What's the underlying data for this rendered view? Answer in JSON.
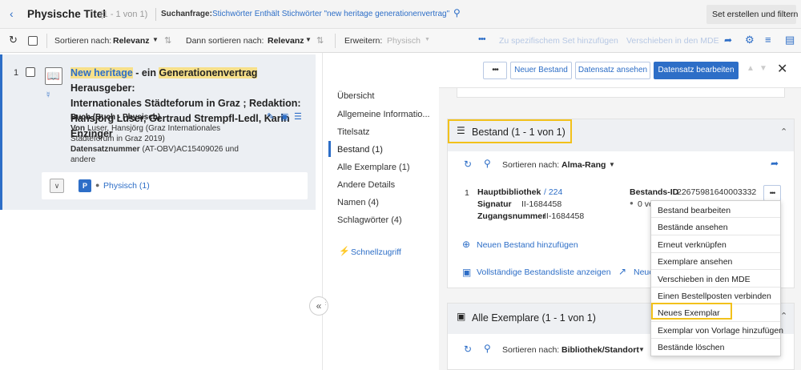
{
  "header": {
    "title": "Physische Titel",
    "count": "(1 - 1 von 1)",
    "query_label": "Suchanfrage:",
    "query_text": "Stichwörter Enthält Stichwörter \"new heritage generationenvertrag\"",
    "set_button": "Set erstellen und filtern"
  },
  "toolbar": {
    "sort_label": "Sortieren nach:",
    "sort_value": "Relevanz",
    "then_sort_label": "Dann sortieren nach:",
    "then_sort_value": "Relevanz",
    "expand_label": "Erweitern:",
    "expand_value": "Physisch",
    "add_to_set": "Zu spezifischem Set hinzufügen",
    "move_mde": "Verschieben in den MDE"
  },
  "result": {
    "number": "1",
    "title_part1": "New heritage",
    "title_part2": " - ein ",
    "title_part3": "Generationenvertrag",
    "title_part4": " Herausgeber:",
    "title_line2": "Internationales Städteforum in Graz ; Redaktion:",
    "title_line3": "Hansjörg Luser, Gertraud Strempfl-Ledl, Karin Enzinger",
    "type": "Buch (Buch - Physisch)",
    "von_label": "Von",
    "von_value": "Luser, Hansjörg (Graz Internationales",
    "von_line2": "Städteforum in Graz 2019)",
    "record_label": "Datensatznummer",
    "record_value": "(AT-OBV)AC15409026 und",
    "record_line2": "andere",
    "phys_badge": "P",
    "phys_link": "Physisch (1)"
  },
  "nav": {
    "items": [
      "Übersicht",
      "Allgemeine Informatio...",
      "Titelsatz",
      "Bestand (1)",
      "Alle Exemplare (1)",
      "Andere Details",
      "Namen (4)",
      "Schlagwörter (4)"
    ],
    "quick": "Schnellzugriff"
  },
  "actions": {
    "more": "•••",
    "new_holding": "Neuer Bestand",
    "view_record": "Datensatz ansehen",
    "edit_record": "Datensatz bearbeiten"
  },
  "bestand": {
    "title": "Bestand (1 - 1 von 1)",
    "sort_label": "Sortieren nach:",
    "sort_value": "Alma-Rang",
    "row_number": "1",
    "library": "Hauptbibliothek",
    "library_code": "/ 224",
    "signatur_label": "Signatur",
    "signatur_value": "II-1684458",
    "zugang_label": "Zugangsnummer",
    "zugang_value": "II-1684458",
    "bestands_id_label": "Bestands-ID",
    "bestands_id_value": "22675981640003332",
    "status_partial": "0 ve",
    "add_holding": "Neuen Bestand hinzufügen",
    "full_list": "Vollständige Bestandsliste anzeigen",
    "new_partial": "Neue"
  },
  "exemplare": {
    "title": "Alle Exemplare (1 - 1 von 1)",
    "sort_label": "Sortieren nach:",
    "sort_value": "Bibliothek/Standort"
  },
  "dropdown": {
    "items": [
      "Bestand bearbeiten",
      "Bestände ansehen",
      "Erneut verknüpfen",
      "Exemplare ansehen",
      "Verschieben in den MDE",
      "Einen Bestellposten verbinden",
      "Neues Exemplar",
      "Exemplar von Vorlage hinzufügen",
      "Bestände löschen"
    ],
    "highlighted": "Neues Exemplar"
  },
  "colors": {
    "accent": "#2d6ec7",
    "highlight_box": "#f2c11b",
    "title_highlight": "#f7e08a"
  }
}
